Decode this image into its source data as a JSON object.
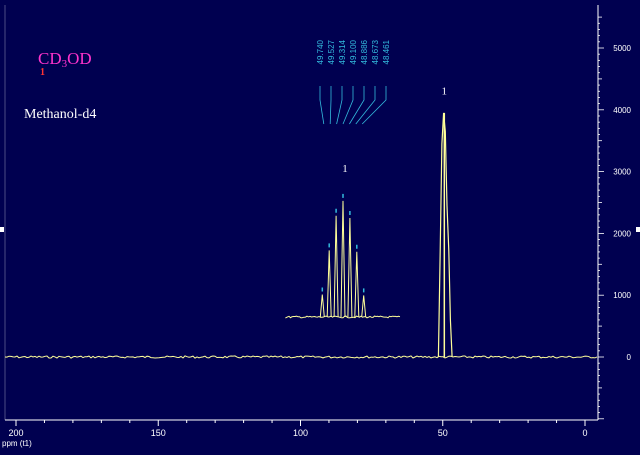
{
  "compound": {
    "formula_main": "CD",
    "formula_sub": "3",
    "formula_tail": "OD",
    "atom_label": "1",
    "solvent_name": "Methanol-d4"
  },
  "peak_list": [
    "49.740",
    "49.527",
    "49.314",
    "49.100",
    "48.886",
    "48.673",
    "48.461"
  ],
  "colors": {
    "background": "#000050",
    "axis": "#ffffff",
    "spectrum": "#ffff99",
    "formula": "#ff33cc",
    "atom_number": "#ff3333",
    "peak_label": "#33bbdd",
    "text": "#ffffff"
  },
  "chart_data": {
    "type": "line",
    "title": "",
    "xlabel": "ppm (t1)",
    "ylabel": "",
    "xlim": [
      205,
      -2
    ],
    "ylim": [
      -1000,
      5600
    ],
    "x_ticks": [
      200,
      150,
      100,
      50,
      0
    ],
    "y_ticks": [
      0,
      1000,
      2000,
      3000,
      4000,
      5000
    ],
    "x_reversed": true,
    "series": [
      {
        "values": [
          {
            "x": 205,
            "y": 0
          },
          {
            "x": 49.96,
            "y": 0
          },
          {
            "x": 49.74,
            "y": 1720
          },
          {
            "x": 49.53,
            "y": 3450
          },
          {
            "x": 49.31,
            "y": 3950
          },
          {
            "x": 49.1,
            "y": 3650
          },
          {
            "x": 48.89,
            "y": 2450
          },
          {
            "x": 48.67,
            "y": 1720
          },
          {
            "x": 48.46,
            "y": 600
          },
          {
            "x": 48.25,
            "y": 0
          },
          {
            "x": -2,
            "y": 0
          }
        ]
      }
    ],
    "annotations": [
      {
        "text": "1",
        "kind": "integral_label",
        "x": 49.1
      },
      {
        "text": "1",
        "kind": "expansion_label"
      }
    ],
    "inset": {
      "description_peaks": [
        {
          "x": 49.74,
          "y": 500
        },
        {
          "x": 49.527,
          "y": 1480
        },
        {
          "x": 49.314,
          "y": 2250
        },
        {
          "x": 49.1,
          "y": 2580
        },
        {
          "x": 48.886,
          "y": 2200
        },
        {
          "x": 48.673,
          "y": 1450
        },
        {
          "x": 48.461,
          "y": 480
        }
      ]
    }
  }
}
